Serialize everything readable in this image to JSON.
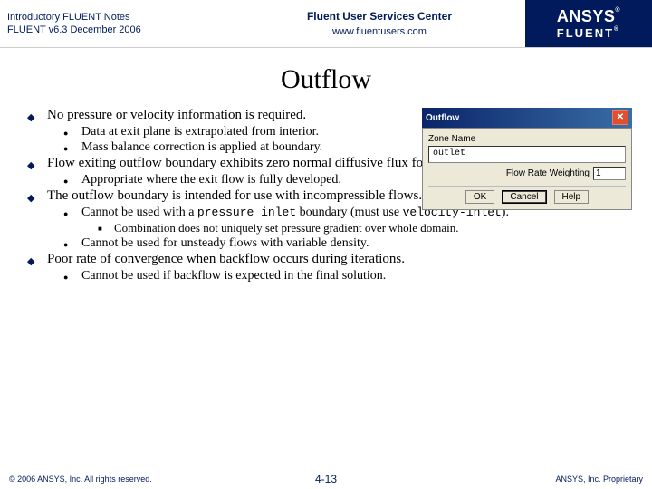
{
  "header": {
    "left_line1": "Introductory FLUENT Notes",
    "left_line2": "FLUENT v6.3 December 2006",
    "center_line1": "Fluent User Services Center",
    "center_line2": "www.fluentusers.com",
    "logo_top": "ANSYS",
    "logo_bottom": "FLUENT"
  },
  "title": "Outflow",
  "bullets": {
    "b1": "No pressure or velocity information is required.",
    "b1a": "Data at exit plane is extrapolated from interior.",
    "b1b": "Mass balance correction is applied at boundary.",
    "b2": "Flow exiting outflow boundary exhibits zero normal diffusive flux for all flow variables.",
    "b2a": "Appropriate where the exit flow is fully developed.",
    "b3": "The outflow boundary is intended for use with incompressible flows.",
    "b3a_pre": "Cannot be used with a ",
    "b3a_code1": "pressure inlet",
    "b3a_mid": " boundary (must use ",
    "b3a_code2": "velocity-inlet",
    "b3a_post": ").",
    "b3a1": "Combination does not uniquely set pressure gradient over whole domain.",
    "b3b": "Cannot be used for unsteady flows with variable density.",
    "b4": "Poor rate of convergence when backflow occurs during iterations.",
    "b4a": "Cannot be used if backflow is expected in the final solution."
  },
  "dialog": {
    "title": "Outflow",
    "zone_label": "Zone Name",
    "zone_value": "outlet",
    "weight_label": "Flow Rate Weighting",
    "weight_value": "1",
    "ok": "OK",
    "cancel": "Cancel",
    "help": "Help"
  },
  "footer": {
    "left": "© 2006 ANSYS, Inc. All rights reserved.",
    "center": "4-13",
    "right": "ANSYS, Inc. Proprietary"
  }
}
